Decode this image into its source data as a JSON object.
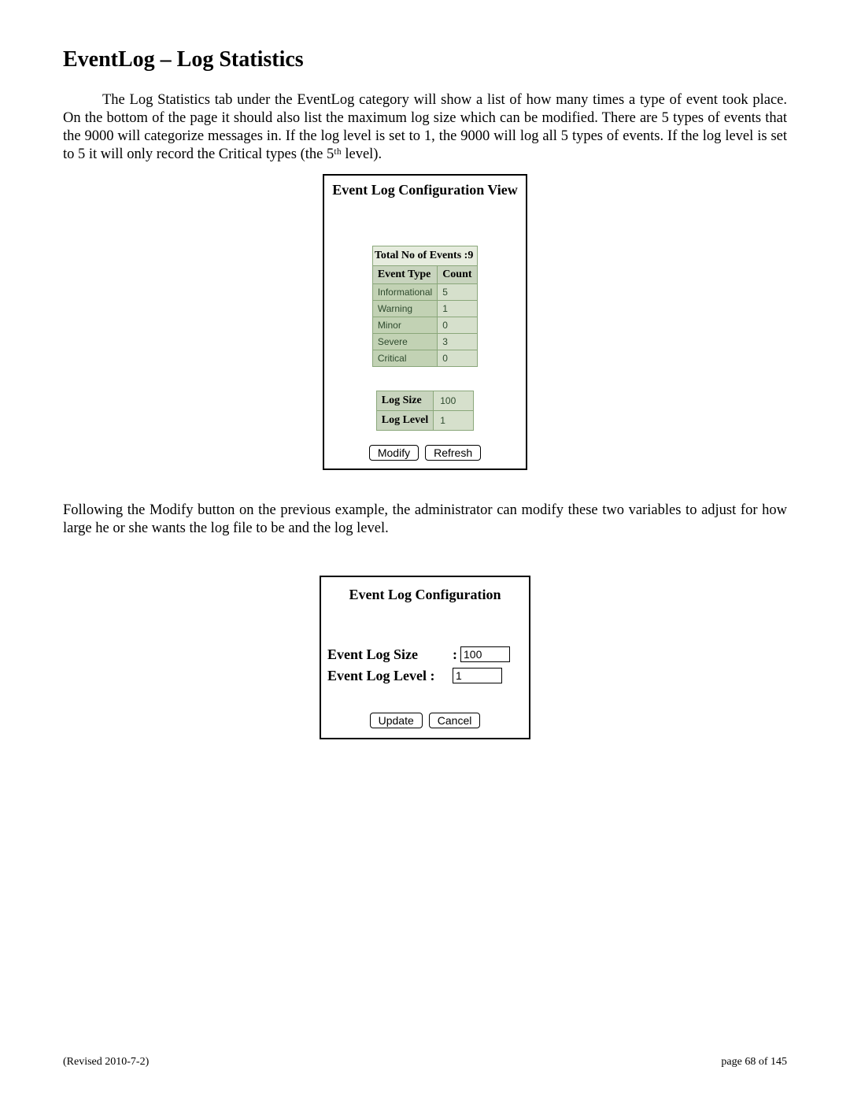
{
  "heading": "EventLog – Log Statistics",
  "para1": "The Log Statistics tab under the EventLog category will show a list of how many times a type of event took place.  On the bottom of the page it should also list the maximum log size which can be modified.  There are 5 types of events that the 9000 will categorize messages in.  If the log level is set to 1, the 9000 will log all 5 types of events.  If the log level is set to 5 it will only record the Critical types (the 5ᵗʰ level).",
  "panel1": {
    "title": "Event Log Configuration View",
    "total_label": "Total No of Events :",
    "total_value": "9",
    "columns": {
      "c1": "Event Type",
      "c2": "Count"
    },
    "rows": [
      {
        "type": "Informational",
        "count": "5"
      },
      {
        "type": "Warning",
        "count": "1"
      },
      {
        "type": "Minor",
        "count": "0"
      },
      {
        "type": "Severe",
        "count": "3"
      },
      {
        "type": "Critical",
        "count": "0"
      }
    ],
    "log_size_label": "Log Size",
    "log_size_value": "100",
    "log_level_label": "Log Level",
    "log_level_value": "1",
    "modify_btn": "Modify",
    "refresh_btn": "Refresh"
  },
  "para2": "Following the Modify button on the previous example, the administrator can modify these two variables to adjust for how large he or she wants the log file to be and the log level.",
  "panel2": {
    "title": "Event Log Configuration",
    "size_label": "Event Log Size",
    "level_label": "Event Log Level :",
    "size_value": "100",
    "level_value": "1",
    "update_btn": "Update",
    "cancel_btn": "Cancel"
  },
  "footer": {
    "left": "(Revised 2010-7-2)",
    "right": "page 68 of 145"
  }
}
